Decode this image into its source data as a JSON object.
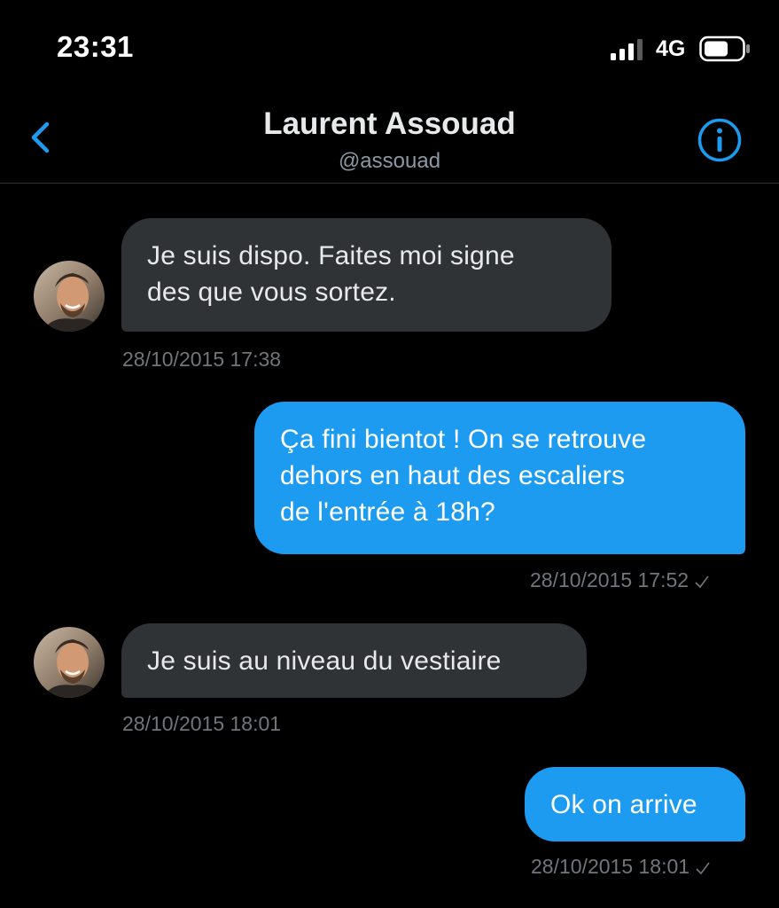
{
  "status_bar": {
    "time": "23:31",
    "network": "4G"
  },
  "header": {
    "title": "Laurent Assouad",
    "handle": "@assouad"
  },
  "messages": [
    {
      "direction": "in",
      "text": "Je suis dispo. Faites moi signe\ndes que vous sortez.",
      "timestamp": "28/10/2015 17:38"
    },
    {
      "direction": "out",
      "text": "Ça fini bientot ! On se retrouve\ndehors en haut des escaliers\nde l'entrée à 18h?",
      "timestamp": "28/10/2015 17:52"
    },
    {
      "direction": "in",
      "text": "Je suis au niveau du vestiaire",
      "timestamp": "28/10/2015 18:01"
    },
    {
      "direction": "out",
      "text": "Ok on arrive",
      "timestamp": "28/10/2015 18:01"
    }
  ],
  "colors": {
    "background": "#000000",
    "accent": "#1d9bf0",
    "incoming_bubble": "#2f3336",
    "secondary_text": "#71767b"
  },
  "icons": {
    "back": "chevron-left-icon",
    "info": "info-icon",
    "signal": "cellular-signal-icon",
    "battery": "battery-icon",
    "read_receipt": "checkmark-icon"
  }
}
